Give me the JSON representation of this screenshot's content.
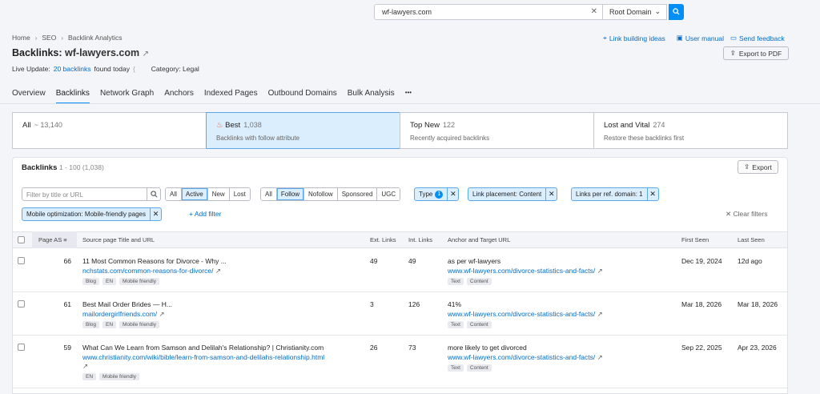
{
  "search": {
    "value": "wf-lawyers.com",
    "scope": "Root Domain"
  },
  "breadcrumb": [
    "Home",
    "SEO",
    "Backlink Analytics"
  ],
  "header": {
    "title_prefix": "Backlinks:",
    "domain": "wf-lawyers.com",
    "live_update": "Live Update:",
    "found_link": "20 backlinks",
    "found_suffix": "found today",
    "category": "Category: Legal"
  },
  "toplinks": {
    "ideas": "Link building ideas",
    "manual": "User manual",
    "feedback": "Send feedback",
    "pdf": "Export to PDF"
  },
  "tabs": [
    "Overview",
    "Backlinks",
    "Network Graph",
    "Anchors",
    "Indexed Pages",
    "Outbound Domains",
    "Bulk Analysis",
    "•••"
  ],
  "summary": [
    {
      "title": "All",
      "count": "~ 13,140",
      "desc": ""
    },
    {
      "title": "Best",
      "count": "1,038",
      "desc": "Backlinks with follow attribute"
    },
    {
      "title": "Top New",
      "count": "122",
      "desc": "Recently acquired backlinks"
    },
    {
      "title": "Lost and Vital",
      "count": "274",
      "desc": "Restore these backlinks first"
    }
  ],
  "table": {
    "title": "Backlinks",
    "range": "1 - 100 (1,038)",
    "export": "Export",
    "filter_placeholder": "Filter by title or URL",
    "status_seg": [
      "All",
      "Active",
      "New",
      "Lost"
    ],
    "type_seg": [
      "All",
      "Follow",
      "Nofollow",
      "Sponsored",
      "UGC"
    ],
    "chips": {
      "type": "Type",
      "type_count": "1",
      "placement": "Link placement: Content",
      "per_domain": "Links per ref. domain: 1",
      "mobile": "Mobile optimization: Mobile-friendly pages"
    },
    "add_filter": "+ Add filter",
    "clear_filters": "Clear filters",
    "headers": {
      "page_as": "Page AS",
      "source": "Source page Title and URL",
      "ext": "Ext. Links",
      "int": "Int. Links",
      "anchor": "Anchor and Target URL",
      "first": "First Seen",
      "last": "Last Seen"
    },
    "rows": [
      {
        "as": "66",
        "title": "11 Most Common Reasons for Divorce - Why ...",
        "url": "nchstats.com/common-reasons-for-divorce/",
        "tags": [
          "Blog",
          "EN",
          "Mobile friendly"
        ],
        "ext": "49",
        "int": "49",
        "anchor": "as per wf-lawyers",
        "target": "www.wf-lawyers.com/divorce-statistics-and-facts/",
        "ttags": [
          "Text",
          "Content"
        ],
        "first": "Dec 19, 2024",
        "last": "12d ago"
      },
      {
        "as": "61",
        "title": "Best Mail Order Brides — H...",
        "url": "mailordergirlfriends.com/",
        "tags": [
          "Blog",
          "EN",
          "Mobile friendly"
        ],
        "ext": "3",
        "int": "126",
        "anchor": "41%",
        "target": "www.wf-lawyers.com/divorce-statistics-and-facts/",
        "ttags": [
          "Text",
          "Content"
        ],
        "first": "Mar 18, 2026",
        "last": "Mar 18, 2026"
      },
      {
        "as": "59",
        "title": "What Can We Learn from Samson and Delilah's Relationship? | Christianity.com",
        "url": "www.christianity.com/wiki/bible/learn-from-samson-and-delilahs-relationship.html",
        "tags": [
          "EN",
          "Mobile friendly"
        ],
        "ext": "26",
        "int": "73",
        "anchor": "more likely to get divorced",
        "target": "www.wf-lawyers.com/divorce-statistics-and-facts/",
        "ttags": [
          "Text",
          "Content"
        ],
        "first": "Sep 22, 2025",
        "last": "Apr 23, 2026"
      }
    ]
  }
}
